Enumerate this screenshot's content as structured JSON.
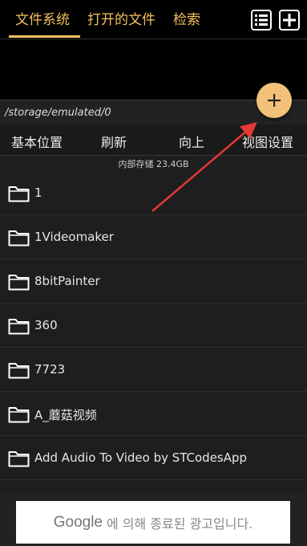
{
  "tabs": [
    {
      "label": "文件系统"
    },
    {
      "label": "打开的文件"
    },
    {
      "label": "检索"
    }
  ],
  "path": "/storage/emulated/0",
  "toolbar": {
    "home": "基本位置",
    "refresh": "刷新",
    "up": "向上",
    "view": "视图设置"
  },
  "storage_label": "内部存储 23.4GB",
  "fab_icon": "plus-icon",
  "folders": [
    {
      "name": "1"
    },
    {
      "name": "1Videomaker"
    },
    {
      "name": "8bitPainter"
    },
    {
      "name": "360"
    },
    {
      "name": "7723"
    },
    {
      "name": "A_蘑菇视频"
    },
    {
      "name": "Add Audio To Video by STCodesApp"
    }
  ],
  "ad": {
    "brand": "Google",
    "text": "에 의해 종료된 광고입니다."
  },
  "colors": {
    "accent": "#f0c060",
    "fab": "#f3c27a",
    "arrow": "#e53935"
  }
}
